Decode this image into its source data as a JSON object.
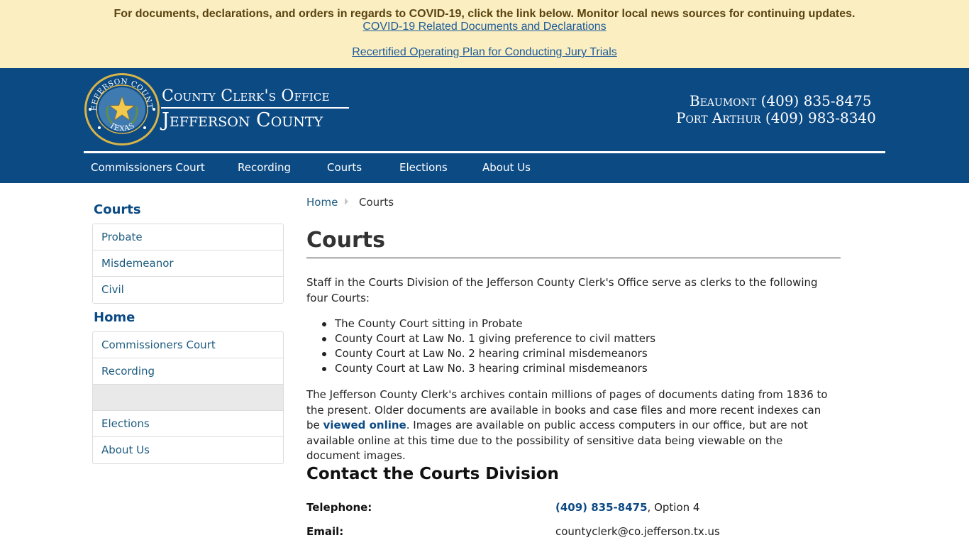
{
  "alert": {
    "message": "For documents, declarations, and orders in regards to COVID-19, click the link below. Monitor local news sources for continuing updates.",
    "link1": "COVID-19 Related Documents and Declarations",
    "link2": "Recertified Operating Plan for Conducting Jury Trials"
  },
  "header": {
    "seal_top_text": "JEFFERSON COUNTY",
    "seal_bottom_text": "TEXAS",
    "office": "County Clerk's Office",
    "county": "Jefferson County",
    "phone_beaumont": "Beaumont (409) 835-8475",
    "phone_port_arthur": "Port Arthur (409) 983-8340"
  },
  "nav": {
    "items": [
      "Commissioners Court",
      "Recording",
      "Courts",
      "Elections",
      "About Us"
    ]
  },
  "sidebar": {
    "courts_heading": "Courts",
    "courts_items": [
      "Probate",
      "Misdemeanor",
      "Civil"
    ],
    "home_heading": "Home",
    "home_items": [
      "Commissioners Court",
      "Recording",
      "",
      "Elections",
      "About Us"
    ]
  },
  "breadcrumb": {
    "home": "Home",
    "current": "Courts"
  },
  "main": {
    "title": "Courts",
    "intro": "Staff in the Courts Division of the Jefferson County Clerk's Office serve as clerks to the following four Courts:",
    "courts": [
      "The County Court sitting in Probate",
      "County Court at Law No. 1 giving preference to civil matters",
      "County Court at Law No. 2 hearing criminal misdemeanors",
      "County Court at Law No. 3 hearing criminal misdemeanors"
    ],
    "archives_before": "The Jefferson County Clerk's archives contain millions of pages of documents dating from 1836 to the present. Older documents are available in books and case files and more recent indexes can be ",
    "archives_link": "viewed online",
    "archives_after": ". Images are available on public access computers in our office, but are not available online at this time due to the possibility of sensitive data being viewable on the document images.",
    "contact_heading": "Contact the Courts Division",
    "telephone_label": "Telephone:",
    "telephone_number": "(409) 835-8475",
    "telephone_option": ", Option 4",
    "email_label": "Email:",
    "email_value": "countyclerk@co.jefferson.tx.us"
  },
  "colors": {
    "banner_bg": "#fbefc2",
    "header_bg": "#0c4a84",
    "link": "#1f5c80",
    "seal_gold": "#d8b449"
  }
}
